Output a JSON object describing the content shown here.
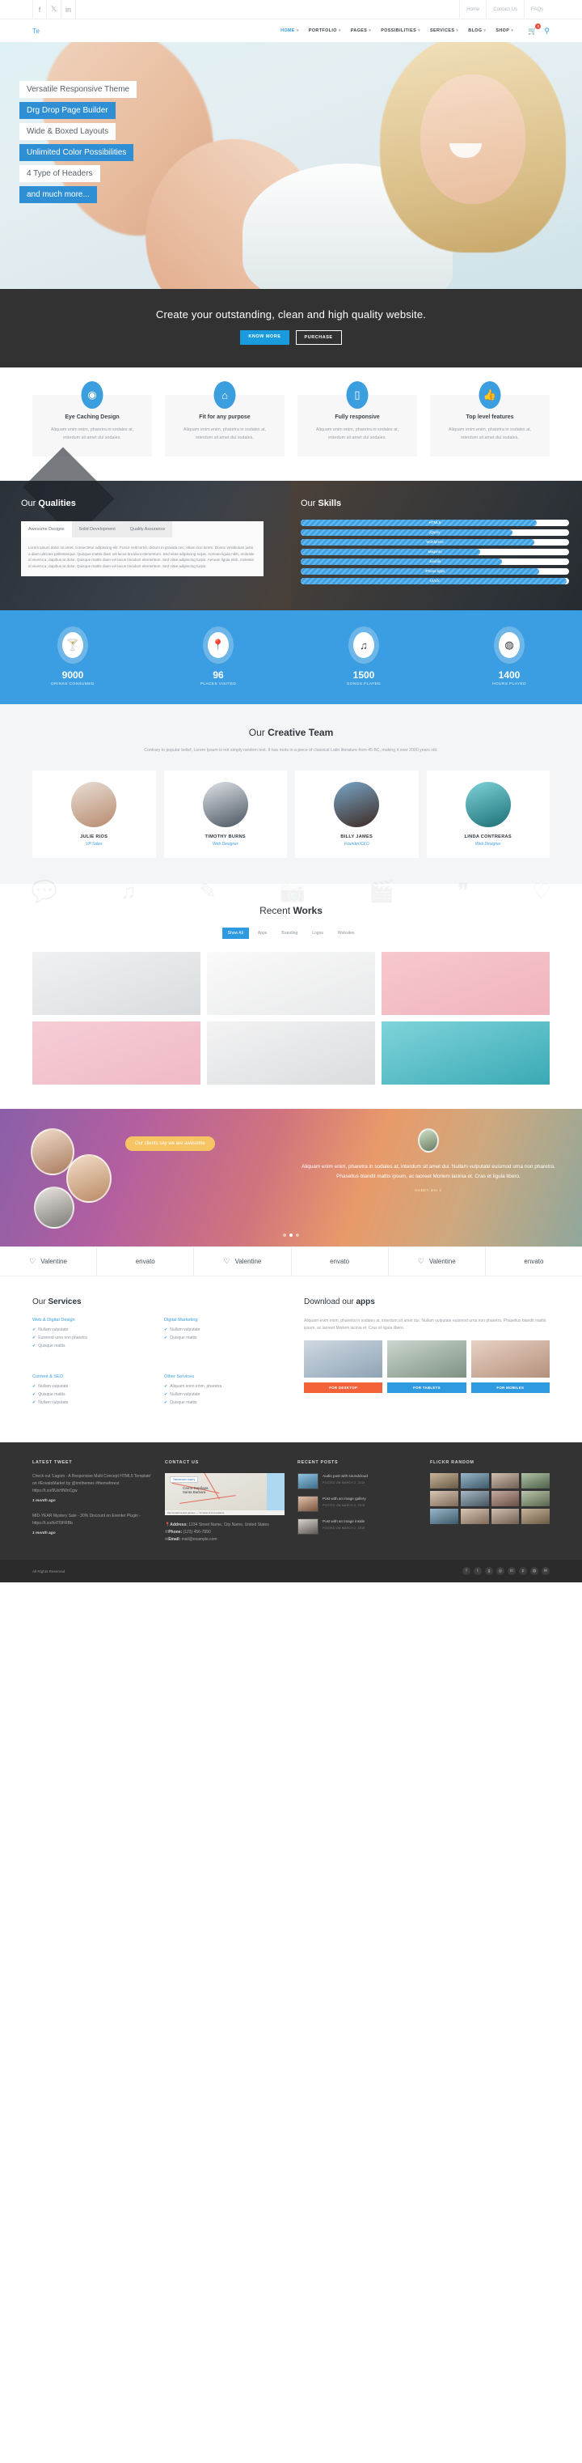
{
  "topbar": {
    "social": [
      {
        "name": "facebook-icon",
        "glyph": "f"
      },
      {
        "name": "twitter-icon",
        "glyph": "🐦"
      },
      {
        "name": "linkedin-icon",
        "glyph": "in"
      }
    ],
    "links": [
      "Home",
      "Contact Us",
      "FAQs"
    ]
  },
  "nav": {
    "logo": "Te",
    "items": [
      {
        "label": "HOME",
        "active": true
      },
      {
        "label": "PORTFOLIO",
        "active": false
      },
      {
        "label": "PAGES",
        "active": false
      },
      {
        "label": "POSSIBILITIES",
        "active": false
      },
      {
        "label": "SERVICES",
        "active": false
      },
      {
        "label": "BLOG",
        "active": false
      },
      {
        "label": "SHOP",
        "active": false
      }
    ],
    "cart_count": "0"
  },
  "hero": {
    "lines": [
      {
        "text": "Versatile Responsive Theme",
        "style": "light"
      },
      {
        "text": "Drg Drop Page Builder",
        "style": "blue"
      },
      {
        "text": "Wide & Boxed Layouts",
        "style": "light"
      },
      {
        "text": "Unlimited Color Possibilities",
        "style": "blue"
      },
      {
        "text": "4 Type of Headers",
        "style": "light"
      },
      {
        "text": "and much more...",
        "style": "blue"
      }
    ]
  },
  "cta": {
    "heading": "Create your outstanding, clean and high quality website.",
    "primary": "KNOW MORE",
    "secondary": "PURCHASE"
  },
  "features": {
    "items": [
      {
        "icon": "eye-icon",
        "glyph": "◉",
        "title": "Eye Caching Design",
        "text": "Aliquam enim enim, pharetra in sodales at, interdum sit amet dui sodales."
      },
      {
        "icon": "magic-icon",
        "glyph": "⌒",
        "title": "Fit for any purpose",
        "text": "Aliquam enim enim, pharetra in sodales at, interdum sit amet dui sodales."
      },
      {
        "icon": "mobile-icon",
        "glyph": "▯",
        "title": "Fully responsive",
        "text": "Aliquam enim enim, pharetra in sodales at, interdum sit amet dui sodales."
      },
      {
        "icon": "thumbs-up-icon",
        "glyph": "👍",
        "title": "Top level features",
        "text": "Aliquam enim enim, pharetra in sodales at, interdum sit amet dui sodales."
      }
    ]
  },
  "qualities": {
    "title_light": "Our ",
    "title_bold": "Qualities",
    "tabs": [
      {
        "label": "Awesome Designs",
        "active": true
      },
      {
        "label": "Solid Development",
        "active": false
      },
      {
        "label": "Quality Assurance",
        "active": false
      }
    ],
    "body": "Lorem ipsum dolor sit amet, consectetur adipiscing elit. Fusce velit tortor, dictum in gravida nec, etiam non lorem. Donec vestibulum justo a diam ultricies pellentesque. Quisque mattis diam vel lacus tincidunt elementum. Sed vitae adipiscing turpis. Aenean ligula nibh, molestie id viverra a, dapibus at dolor. Quisque mattis diam vel lacus tincidunt elementum. Sed vitae adipiscing turpis. Aenean ligula nibh, molestie id viverra a, dapibus at dolor. Quisque mattis diam vel lacus tincidunt elementum. Sed vitae adipiscing turpis."
  },
  "skills": {
    "title_light": "Our ",
    "title_bold": "Skills",
    "chart_data": {
      "type": "bar",
      "title": "Our Skills",
      "categories": [
        "HTML5",
        "jQuery",
        "Wordpress",
        "Magento",
        "Joomla",
        "iPhone apps",
        "UI/UX"
      ],
      "values": [
        88,
        79,
        87,
        67,
        75,
        89,
        99
      ],
      "xlabel": "",
      "ylabel": "",
      "ylim": [
        0,
        100
      ]
    }
  },
  "counters": {
    "items": [
      {
        "icon": "cocktail-icon",
        "glyph": "🍸",
        "value": "9000",
        "label": "DRINKS CONSUMED"
      },
      {
        "icon": "map-pin-icon",
        "glyph": "📍",
        "value": "96",
        "label": "PLACES VISITED"
      },
      {
        "icon": "music-note-icon",
        "glyph": "♫",
        "value": "1500",
        "label": "SONGS PLAYED"
      },
      {
        "icon": "dribbble-icon",
        "glyph": "◍",
        "value": "1400",
        "label": "HOURS PLAYED"
      }
    ]
  },
  "team": {
    "title_light": "Our ",
    "title_bold": "Creative Team",
    "lead": "Contrary to popular belief, Lorem Ipsum is not simply random text. It has roots in a piece of classical Latin literature from 45 BC, making it over 2000 years old.",
    "members": [
      {
        "name": "JULIE RIOS",
        "role": "VP Sales"
      },
      {
        "name": "TIMOTHY BURNS",
        "role": "Web Designer"
      },
      {
        "name": "BILLY JAMES",
        "role": "Founder/CEO"
      },
      {
        "name": "LINDA CONTRERAS",
        "role": "Web Designer"
      }
    ]
  },
  "works": {
    "title_light": "Recent ",
    "title_bold": "Works",
    "filters": [
      {
        "label": "Show All",
        "active": true
      },
      {
        "label": "Apps",
        "active": false
      },
      {
        "label": "Branding",
        "active": false
      },
      {
        "label": "Logos",
        "active": false
      },
      {
        "label": "Websites",
        "active": false
      }
    ]
  },
  "testimonials": {
    "bubble": "Our clients say we are awesome",
    "quote": "Aliquam enim enim, pharetra in sodales at, interdum sit amet dui. Nullam vulputate euismod urna non pharetra. Phasellus blandit mattis ipsum, ac laoreet Morlem lacinia et. Cras et ligula libero.",
    "author": "HABEY BAI 2"
  },
  "brands": {
    "items": [
      {
        "heart": "♡",
        "name": "Valentine"
      },
      {
        "heart": "",
        "name": "envato"
      },
      {
        "heart": "♡",
        "name": "Valentine"
      },
      {
        "heart": "",
        "name": "envato"
      },
      {
        "heart": "♡",
        "name": "Valentine"
      },
      {
        "heart": "",
        "name": "envato"
      }
    ]
  },
  "services": {
    "title_light": "Our ",
    "title_bold": "Services",
    "groups": [
      {
        "title": "Web & Digital Design",
        "items": [
          "Nullam vulputate",
          "Euismod urna non pharetra",
          "Quisque mattis"
        ]
      },
      {
        "title": "Digital Marketing",
        "items": [
          "Nullam vulputate",
          "Quisque mattis"
        ]
      },
      {
        "title": "Content & SEO",
        "items": [
          "Nullam vulputate",
          "Quisque mattis",
          "Nullam vulputate"
        ]
      },
      {
        "title": "Other Services",
        "items": [
          "Aliquam enim enim, pharetra",
          "Nullam vulputate",
          "Quisque mattis"
        ]
      }
    ]
  },
  "apps": {
    "title_light": "Download our ",
    "title_bold": "apps",
    "text": "Aliquam enim enim, pharetra in sodales at, interdum sit amet dui. Nullam vulputate euismod urna non pharetra. Phasellus blandit mattis ipsum, ac laoreet Morlem lacinia et. Cras et ligula libero.",
    "buttons": [
      "FOR DESKTOP",
      "FOR TABLETS",
      "FOR MOBILES"
    ]
  },
  "footer": {
    "tweet_heading": "LATEST TWEET",
    "tweets": [
      {
        "text": "Check out 'Lagom - A Responsive Multi Concept HTML5 Template' on #EnvatoMarket by @irnithemes #themeforest https://t.co/9UsHiWnCgw",
        "time": "1 month ago"
      },
      {
        "text": "MID-YEAR Mystery Sale - 30% Discount on Eventer Plugin - https://t.co/totTl9FRBb",
        "time": "1 month ago"
      }
    ],
    "contact_heading": "CONTACT US",
    "map_tip": "Увеличить карту",
    "map_label": "Санта-Барбара",
    "map_label2": "Santa Barbara",
    "map_footer": "Картографические данные — Условия использования",
    "address_label": "Address:",
    "address_value": "1234 Street Name, City Name, United States",
    "phone_label": "Phone:",
    "phone_value": "(123) 456-7890",
    "email_label": "Email:",
    "email_value": "mail@example.com",
    "posts_heading": "RECENT POSTS",
    "posts": [
      {
        "title": "Audio post with soundcloud",
        "date": "POSTED ON MARCH 2, 2015"
      },
      {
        "title": "Post with an image gallery",
        "date": "POSTED ON MARCH 2, 2015"
      },
      {
        "title": "Post with an image inside",
        "date": "POSTED ON MARCH 2, 2015"
      }
    ],
    "flickr_heading": "FLICKR RANDOM",
    "copyright": "All Rights Reserved",
    "social": [
      "f",
      "t",
      "g+",
      "in",
      "◉",
      "p",
      "☉",
      "✉"
    ]
  },
  "colors": {
    "accent": "#2e9ae0",
    "dark": "#333333",
    "cta_bg": "#323232",
    "counter_bg": "#3b9ee2"
  }
}
